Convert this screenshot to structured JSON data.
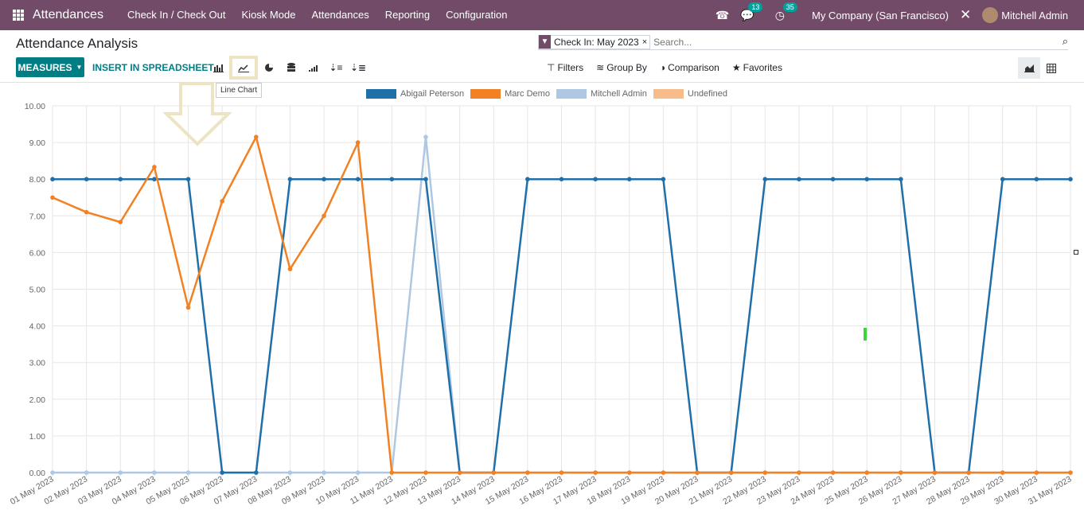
{
  "navbar": {
    "app_name": "Attendances",
    "menu": [
      "Check In / Check Out",
      "Kiosk Mode",
      "Attendances",
      "Reporting",
      "Configuration"
    ],
    "messages_count": "13",
    "activities_count": "35",
    "company": "My Company (San Francisco)",
    "user": "Mitchell Admin"
  },
  "control_panel": {
    "title": "Attendance Analysis",
    "facet": "Check In: May 2023",
    "search_placeholder": "Search...",
    "measures_label": "MEASURES",
    "insert_label": "INSERT IN SPREADSHEET",
    "tooltip": "Line Chart",
    "filters_label": "Filters",
    "groupby_label": "Group By",
    "comparison_label": "Comparison",
    "favorites_label": "Favorites"
  },
  "colors": {
    "abigail": "#1f6fa9",
    "marc": "#f28123",
    "mitchell": "#aec7e3",
    "undefined": "#f7bc8a"
  },
  "chart_data": {
    "type": "line",
    "ylim": [
      0,
      10
    ],
    "yticks": [
      "0.00",
      "1.00",
      "2.00",
      "3.00",
      "4.00",
      "5.00",
      "6.00",
      "7.00",
      "8.00",
      "9.00",
      "10.00"
    ],
    "categories": [
      "01 May 2023",
      "02 May 2023",
      "03 May 2023",
      "04 May 2023",
      "05 May 2023",
      "06 May 2023",
      "07 May 2023",
      "08 May 2023",
      "09 May 2023",
      "10 May 2023",
      "11 May 2023",
      "12 May 2023",
      "13 May 2023",
      "14 May 2023",
      "15 May 2023",
      "16 May 2023",
      "17 May 2023",
      "18 May 2023",
      "19 May 2023",
      "20 May 2023",
      "21 May 2023",
      "22 May 2023",
      "23 May 2023",
      "24 May 2023",
      "25 May 2023",
      "26 May 2023",
      "27 May 2023",
      "28 May 2023",
      "29 May 2023",
      "30 May 2023",
      "31 May 2023"
    ],
    "series": [
      {
        "name": "Abigail Peterson",
        "values": [
          8,
          8,
          8,
          8,
          8,
          0,
          0,
          8,
          8,
          8,
          8,
          8,
          0,
          0,
          8,
          8,
          8,
          8,
          8,
          0,
          0,
          8,
          8,
          8,
          8,
          8,
          0,
          0,
          8,
          8,
          8
        ]
      },
      {
        "name": "Marc Demo",
        "values": [
          7.5,
          7.1,
          6.83,
          8.33,
          4.5,
          7.4,
          9.15,
          5.55,
          7.0,
          9.0,
          0,
          0,
          0,
          0,
          0,
          0,
          0,
          0,
          0,
          0,
          0,
          0,
          0,
          0,
          0,
          0,
          0,
          0,
          0,
          0,
          0
        ]
      },
      {
        "name": "Mitchell Admin",
        "values": [
          0,
          0,
          0,
          0,
          0,
          0,
          0,
          0,
          0,
          0,
          0,
          9.15,
          0,
          0,
          0,
          0,
          0,
          0,
          0,
          0,
          0,
          0,
          0,
          0,
          0,
          0,
          0,
          0,
          0,
          0,
          0
        ]
      },
      {
        "name": "Undefined",
        "values": []
      }
    ]
  }
}
